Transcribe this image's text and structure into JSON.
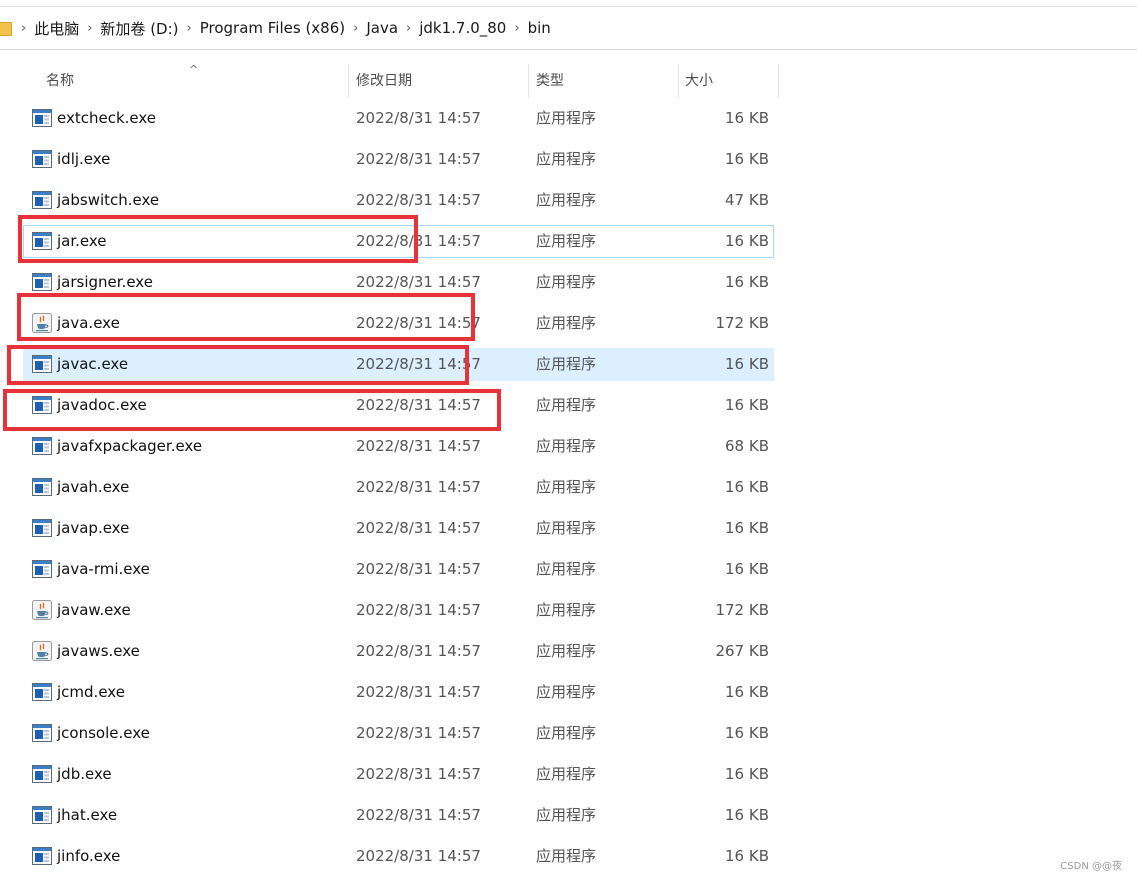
{
  "breadcrumb": [
    "此电脑",
    "新加卷 (D:)",
    "Program Files (x86)",
    "Java",
    "jdk1.7.0_80",
    "bin"
  ],
  "separator": "›",
  "columns": {
    "name": "名称",
    "date": "修改日期",
    "type": "类型",
    "size": "大小"
  },
  "sort_indicator": "^",
  "files": [
    {
      "name": "extcheck.exe",
      "date": "2022/8/31 14:57",
      "type": "应用程序",
      "size": "16 KB",
      "icon": "exe-icon"
    },
    {
      "name": "idlj.exe",
      "date": "2022/8/31 14:57",
      "type": "应用程序",
      "size": "16 KB",
      "icon": "exe-icon"
    },
    {
      "name": "jabswitch.exe",
      "date": "2022/8/31 14:57",
      "type": "应用程序",
      "size": "47 KB",
      "icon": "exe-icon"
    },
    {
      "name": "jar.exe",
      "date": "2022/8/31 14:57",
      "type": "应用程序",
      "size": "16 KB",
      "icon": "exe-icon",
      "state": "hovered"
    },
    {
      "name": "jarsigner.exe",
      "date": "2022/8/31 14:57",
      "type": "应用程序",
      "size": "16 KB",
      "icon": "exe-icon"
    },
    {
      "name": "java.exe",
      "date": "2022/8/31 14:57",
      "type": "应用程序",
      "size": "172 KB",
      "icon": "java-icon"
    },
    {
      "name": "javac.exe",
      "date": "2022/8/31 14:57",
      "type": "应用程序",
      "size": "16 KB",
      "icon": "exe-icon",
      "state": "selected"
    },
    {
      "name": "javadoc.exe",
      "date": "2022/8/31 14:57",
      "type": "应用程序",
      "size": "16 KB",
      "icon": "exe-icon"
    },
    {
      "name": "javafxpackager.exe",
      "date": "2022/8/31 14:57",
      "type": "应用程序",
      "size": "68 KB",
      "icon": "exe-icon"
    },
    {
      "name": "javah.exe",
      "date": "2022/8/31 14:57",
      "type": "应用程序",
      "size": "16 KB",
      "icon": "exe-icon"
    },
    {
      "name": "javap.exe",
      "date": "2022/8/31 14:57",
      "type": "应用程序",
      "size": "16 KB",
      "icon": "exe-icon"
    },
    {
      "name": "java-rmi.exe",
      "date": "2022/8/31 14:57",
      "type": "应用程序",
      "size": "16 KB",
      "icon": "exe-icon"
    },
    {
      "name": "javaw.exe",
      "date": "2022/8/31 14:57",
      "type": "应用程序",
      "size": "172 KB",
      "icon": "java-icon"
    },
    {
      "name": "javaws.exe",
      "date": "2022/8/31 14:57",
      "type": "应用程序",
      "size": "267 KB",
      "icon": "java-icon"
    },
    {
      "name": "jcmd.exe",
      "date": "2022/8/31 14:57",
      "type": "应用程序",
      "size": "16 KB",
      "icon": "exe-icon"
    },
    {
      "name": "jconsole.exe",
      "date": "2022/8/31 14:57",
      "type": "应用程序",
      "size": "16 KB",
      "icon": "exe-icon"
    },
    {
      "name": "jdb.exe",
      "date": "2022/8/31 14:57",
      "type": "应用程序",
      "size": "16 KB",
      "icon": "exe-icon"
    },
    {
      "name": "jhat.exe",
      "date": "2022/8/31 14:57",
      "type": "应用程序",
      "size": "16 KB",
      "icon": "exe-icon"
    },
    {
      "name": "jinfo.exe",
      "date": "2022/8/31 14:57",
      "type": "应用程序",
      "size": "16 KB",
      "icon": "exe-icon"
    }
  ],
  "annotations": [
    "jar.exe",
    "java.exe",
    "javac.exe",
    "javadoc.exe"
  ],
  "annotation_color": "#e8323a",
  "watermark": "CSDN @@夜"
}
